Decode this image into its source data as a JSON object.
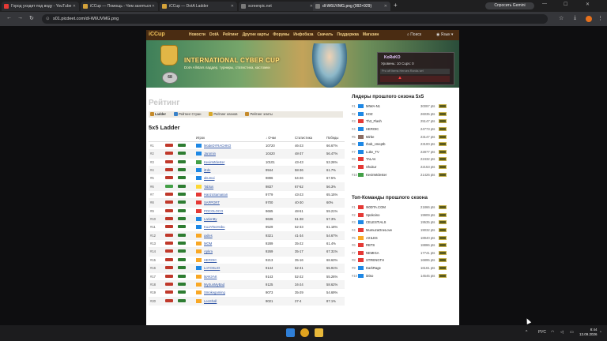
{
  "browser": {
    "tabs": [
      {
        "title": "Город уходит под воду - YouTube",
        "color": "#e53935"
      },
      {
        "title": "iCCup — Помощь - Чем заняться",
        "color": "#d4a23a"
      },
      {
        "title": "iCCup — DotA Ladder",
        "color": "#d4a23a"
      },
      {
        "title": "screenpic.net",
        "color": "#7a7a7a"
      },
      {
        "title": "dl-W6UVMG.png (992×929)",
        "color": "#7a7a7a"
      }
    ],
    "gemini_label": "Спросить Gemini",
    "url": "s01.picdeet.com/dl-W6UVMG.png"
  },
  "site": {
    "logo": "iCCup",
    "nav": [
      "Новости",
      "DotA",
      "Рейтинг",
      "Другие карты",
      "Форумы",
      "Инфобаза",
      "Скачать",
      "Поддержка",
      "Магазин"
    ],
    "search_label": "Поиск",
    "lang_label": "Язык",
    "banner_title": "INTERNATIONAL CYBER CUP",
    "banner_sub": "DotA Allstars ладдер, турниры, статистика, кастомки",
    "banner_level": "68",
    "user": {
      "name": "KoReKO",
      "level_line": "Уровень: 10   Cups: 0",
      "stats_line": "Pro   off   Items   Heroes   Ranks   set",
      "flag_icon": "warning-icon"
    }
  },
  "rating": {
    "page_title": "Рейтинг",
    "tabs": [
      "Ladder",
      "Рейтинг Стран",
      "Рейтинг кланов",
      "Рейтинг элиты"
    ],
    "ladder_title": "5x5 Ladder",
    "columns": {
      "player": "Игрок",
      "points": "↓ Очки",
      "stats": "Статистика",
      "wins": "Победы"
    },
    "rows": [
      {
        "rank": "#1",
        "name": "ModeDYRACHKO",
        "points": "10720",
        "stats": "46-23",
        "pct": "66.67%",
        "b1": "#c0392b",
        "b2": "#2e7d32",
        "flag": "#1e88e5"
      },
      {
        "rank": "#2",
        "name": "Jaromin",
        "points": "10420",
        "stats": "48-37",
        "pct": "56.47%",
        "b1": "#c0392b",
        "b2": "#2e7d32",
        "flag": "#1e88e5"
      },
      {
        "rank": "#3",
        "name": "KevinMclester",
        "points": "10101",
        "stats": "43-43",
        "pct": "53.26%",
        "b1": "#c0392b",
        "b2": "#2e7d32",
        "flag": "#43a047"
      },
      {
        "rank": "#4",
        "name": "iEdo",
        "points": "9944",
        "stats": "58-36",
        "pct": "61.7%",
        "b1": "#c0392b",
        "b2": "#2e7d32",
        "flag": "#1e88e5"
      },
      {
        "rank": "#5",
        "name": "akumai",
        "points": "9896",
        "stats": "54-26",
        "pct": "67.5%",
        "b1": "#c0392b",
        "b2": "#2e7d32",
        "flag": "#1e88e5"
      },
      {
        "rank": "#6",
        "name": "Tablus",
        "points": "9837",
        "stats": "67-52",
        "pct": "56.3%",
        "b1": "#43a047",
        "b2": "#2e7d32",
        "flag": "#fdd835"
      },
      {
        "rank": "#7",
        "name": "HanzoSamanan",
        "points": "9779",
        "stats": "43-23",
        "pct": "65.15%",
        "b1": "#c0392b",
        "b2": "#2e7d32",
        "flag": "#e53935"
      },
      {
        "rank": "#8",
        "name": "SAPPORT",
        "points": "9700",
        "stats": "40-30",
        "pct": "60%",
        "b1": "#c0392b",
        "b2": "#2e7d32",
        "flag": "#e53935"
      },
      {
        "rank": "#9",
        "name": "POCOLOCO",
        "points": "9665",
        "stats": "48-51",
        "pct": "59.21%",
        "b1": "#c0392b",
        "b2": "#2e7d32",
        "flag": "#e53935"
      },
      {
        "rank": "#10",
        "name": "LarionBy",
        "points": "9636",
        "stats": "51-38",
        "pct": "57.3%",
        "b1": "#c0392b",
        "b2": "#2e7d32",
        "flag": "#1e88e5"
      },
      {
        "rank": "#11",
        "name": "KuJATooHobu",
        "points": "9529",
        "stats": "52-33",
        "pct": "61.18%",
        "b1": "#c0392b",
        "b2": "#2e7d32",
        "flag": "#1e88e5"
      },
      {
        "rank": "#12",
        "name": "axiles",
        "points": "9321",
        "stats": "41-34",
        "pct": "54.67%",
        "b1": "#c0392b",
        "b2": "#2e7d32",
        "flag": "#f9a825"
      },
      {
        "rank": "#13",
        "name": "МОМ",
        "points": "9289",
        "stats": "35-22",
        "pct": "61.4%",
        "b1": "#c0392b",
        "b2": "#2e7d32",
        "flag": "#f9a825"
      },
      {
        "rank": "#14",
        "name": "Apkra",
        "points": "9269",
        "stats": "35-17",
        "pct": "67.31%",
        "b1": "#c0392b",
        "b2": "#2e7d32",
        "flag": "#f9a825"
      },
      {
        "rank": "#15",
        "name": "HEROIC",
        "points": "9213",
        "stats": "35-16",
        "pct": "68.63%",
        "b1": "#c0392b",
        "b2": "#2e7d32",
        "flag": "#f9a825"
      },
      {
        "rank": "#16",
        "name": "LoYOSLIO",
        "points": "9144",
        "stats": "52-41",
        "pct": "55.91%",
        "b1": "#c0392b",
        "b2": "#2e7d32",
        "flag": "#1e88e5"
      },
      {
        "rank": "#17",
        "name": "МАКУАК",
        "points": "9143",
        "stats": "52-22",
        "pct": "55.26%",
        "b1": "#c0392b",
        "b2": "#2e7d32",
        "flag": "#f9a825"
      },
      {
        "rank": "#18",
        "name": "MySunMyBad",
        "points": "9125",
        "stats": "34-24",
        "pct": "58.62%",
        "b1": "#c0392b",
        "b2": "#2e7d32",
        "flag": "#f9a825"
      },
      {
        "rank": "#19",
        "name": "Smokegaming",
        "points": "9073",
        "stats": "35-29",
        "pct": "54.69%",
        "b1": "#c0392b",
        "b2": "#2e7d32",
        "flag": "#f9a825"
      },
      {
        "rank": "#20",
        "name": "LeoShall",
        "points": "9021",
        "stats": "27-4",
        "pct": "87.1%",
        "b1": "#c0392b",
        "b2": "#2e7d32",
        "flag": "#f9a825"
      }
    ]
  },
  "leaders": {
    "title": "Лидеры прошлого сезона 5x5",
    "items": [
      {
        "rank": "#1",
        "name": "MIWA-N1",
        "points": "30097 pts",
        "flag": "#1e88e5"
      },
      {
        "rank": "#2",
        "name": "KOZ",
        "points": "26035 pts",
        "flag": "#1e88e5"
      },
      {
        "rank": "#3",
        "name": "Th3_Flash",
        "points": "25147 pts",
        "flag": "#e53935"
      },
      {
        "rank": "#4",
        "name": "HEROIC",
        "points": "24773 pts",
        "flag": "#1e88e5"
      },
      {
        "rank": "#5",
        "name": "Mirbe",
        "points": "23147 pts",
        "flag": "#8d6e63"
      },
      {
        "rank": "#6",
        "name": "rbob_cmeptb",
        "points": "23100 pts",
        "flag": "#1e88e5"
      },
      {
        "rank": "#7",
        "name": "Luke_TV",
        "points": "22877 pts",
        "flag": "#1e88e5"
      },
      {
        "rank": "#8",
        "name": "TALAs",
        "points": "22432 pts",
        "flag": "#e53935"
      },
      {
        "rank": "#9",
        "name": "Shukur",
        "points": "22153 pts",
        "flag": "#e53935"
      },
      {
        "rank": "#10",
        "name": "KevinMclester",
        "points": "21426 pts",
        "flag": "#43a047"
      }
    ]
  },
  "teams": {
    "title": "Топ-Команды прошлого сезона",
    "items": [
      {
        "rank": "#1",
        "name": "!60DTA.COM",
        "points": "21866 pts",
        "flag": "#e53935"
      },
      {
        "rank": "#2",
        "name": "Spokoino",
        "points": "19909 pts",
        "flag": "#e53935"
      },
      {
        "rank": "#3",
        "name": "CELESTIALS",
        "points": "19535 pts",
        "flag": "#1e88e5"
      },
      {
        "rank": "#4",
        "name": "MumuzaOneLove",
        "points": "19032 pts",
        "flag": "#e53935"
      },
      {
        "rank": "#5",
        "name": "AXILES",
        "points": "18940 pts",
        "flag": "#f9a825"
      },
      {
        "rank": "#6",
        "name": "RBTS",
        "points": "18886 pts",
        "flag": "#e53935"
      },
      {
        "rank": "#7",
        "name": "NEMIGA",
        "points": "17741 pts",
        "flag": "#e53935"
      },
      {
        "rank": "#8",
        "name": "STRENGTH",
        "points": "16895 pts",
        "flag": "#e53935"
      },
      {
        "rank": "#9",
        "name": "DarkRage",
        "points": "16161 pts",
        "flag": "#1e88e5"
      },
      {
        "rank": "#10",
        "name": "iDiso",
        "points": "14545 pts",
        "flag": "#1e88e5"
      }
    ]
  },
  "taskbar": {
    "tray": "РУС",
    "time": "8:44",
    "date": "13.09.2026"
  }
}
